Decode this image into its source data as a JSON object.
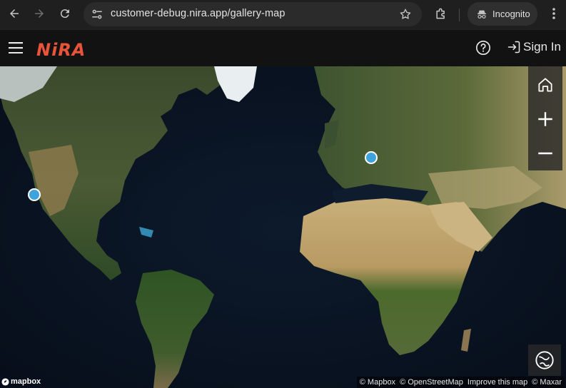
{
  "browser": {
    "url": "customer-debug.nira.app/gallery-map",
    "incognito_label": "Incognito",
    "icons": [
      "back-icon",
      "forward-icon",
      "reload-icon",
      "site-info-icon",
      "bookmark-star-icon",
      "extensions-icon",
      "incognito-icon",
      "kebab-menu-icon"
    ]
  },
  "app": {
    "logo_text": "NiRA",
    "brand_color": "#e8543a",
    "sign_in_label": "Sign In",
    "icons": [
      "hamburger-menu-icon",
      "help-icon",
      "sign-in-icon"
    ]
  },
  "map": {
    "controls": [
      "home-icon",
      "zoom-in-icon",
      "zoom-out-icon",
      "compass-icon"
    ],
    "marker_color": "#3ea2dd",
    "markers": [
      {
        "name": "marker-california"
      },
      {
        "name": "marker-europe"
      }
    ],
    "logo_text": "mapbox",
    "attribution": {
      "mapbox": "© Mapbox",
      "osm": "© OpenStreetMap",
      "improve": "Improve this map",
      "maxar": "© Maxar"
    }
  }
}
